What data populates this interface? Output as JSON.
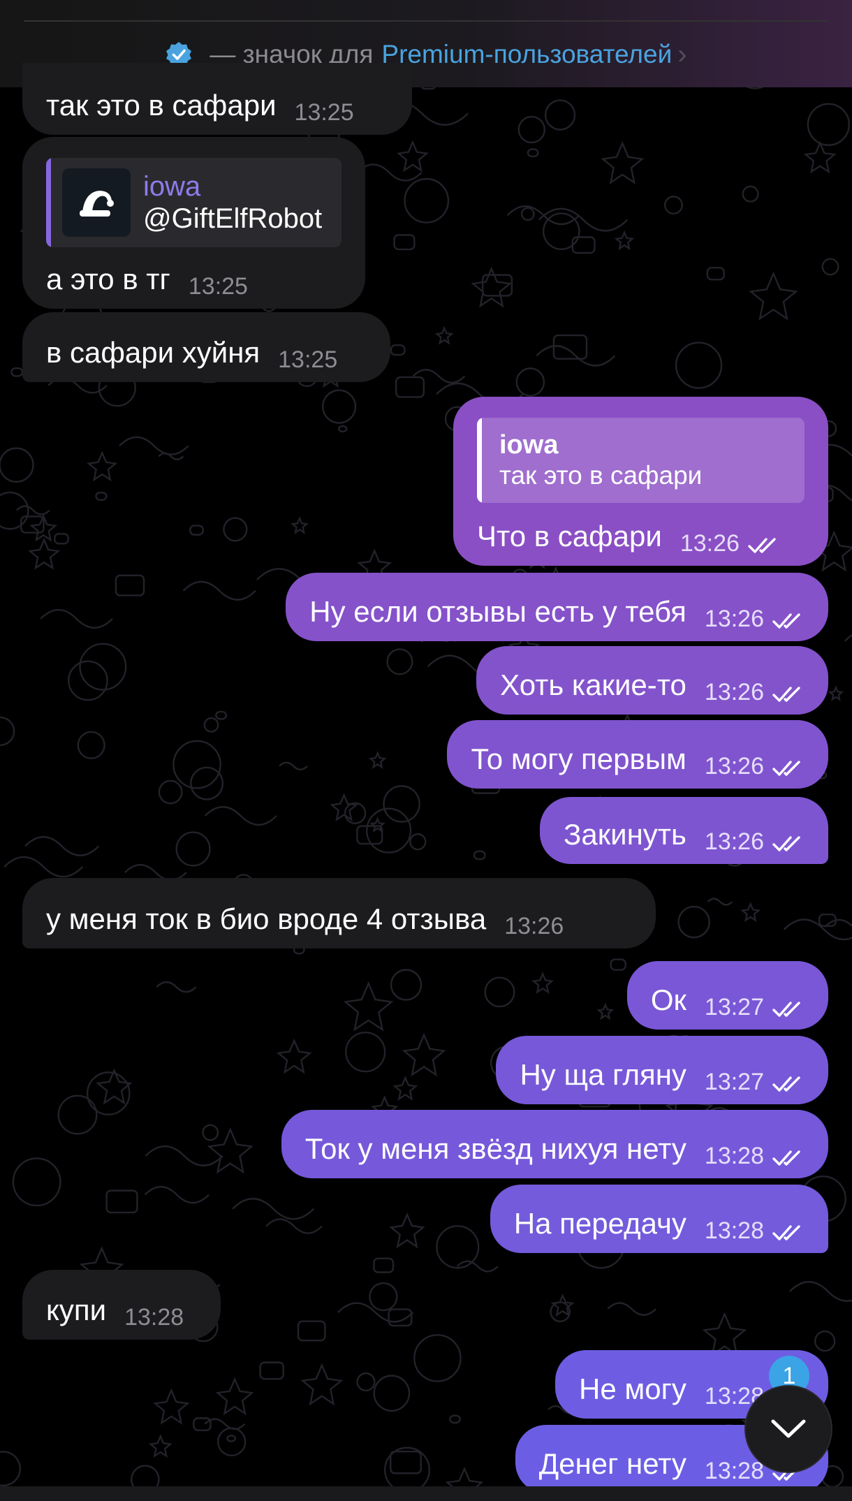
{
  "banner": {
    "badge_icon": "verified-badge-icon",
    "prefix": "— значок для",
    "link": "Premium-пользователей",
    "chevron": "›"
  },
  "messages": [
    {
      "dir": "in",
      "text": "так это в сафари",
      "time": "13:25"
    },
    {
      "dir": "in",
      "text": "а это в тг",
      "time": "13:25",
      "reply": {
        "name": "iowa",
        "text": "@GiftElfRobot",
        "thumb_icon": "elf-hat-icon"
      }
    },
    {
      "dir": "in",
      "text": "в сафари хуйня",
      "time": "13:25"
    },
    {
      "dir": "out",
      "text": "Что в сафари",
      "time": "13:26",
      "reply": {
        "name": "iowa",
        "text": "так это в сафари"
      }
    },
    {
      "dir": "out",
      "text": "Ну если отзывы есть у тебя",
      "time": "13:26"
    },
    {
      "dir": "out",
      "text": "Хоть какие-то",
      "time": "13:26"
    },
    {
      "dir": "out",
      "text": "То могу первым",
      "time": "13:26"
    },
    {
      "dir": "out",
      "text": "Закинуть",
      "time": "13:26"
    },
    {
      "dir": "in",
      "text": "у меня ток в био вроде 4 отзыва",
      "time": "13:26"
    },
    {
      "dir": "out",
      "text": "Ок",
      "time": "13:27"
    },
    {
      "dir": "out",
      "text": "Ну ща гляну",
      "time": "13:27"
    },
    {
      "dir": "out",
      "text": "Ток у меня звёзд нихуя нету",
      "time": "13:28"
    },
    {
      "dir": "out",
      "text": "На передачу",
      "time": "13:28"
    },
    {
      "dir": "in",
      "text": "купи",
      "time": "13:28"
    },
    {
      "dir": "out",
      "text": "Не могу",
      "time": "13:28"
    },
    {
      "dir": "out",
      "text": "Денег нету",
      "time": "13:28"
    }
  ],
  "scroll_button": {
    "icon": "chevron-down-icon",
    "unread_count": "1"
  },
  "colors": {
    "incoming_bubble": "#1c1c1f",
    "outgoing_gradient_top": "#8a4fc4",
    "outgoing_gradient_bottom": "#6a5fe6",
    "link": "#4aa3df"
  }
}
